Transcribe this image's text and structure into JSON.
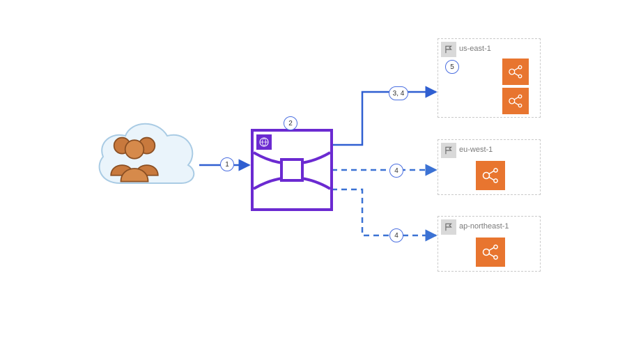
{
  "steps": {
    "s1": "1",
    "s2": "2",
    "s34": "3, 4",
    "s4a": "4",
    "s4b": "4",
    "s5": "5"
  },
  "regions": {
    "r1": "us-east-1",
    "r2": "eu-west-1",
    "r3": "ap-northeast-1"
  },
  "icons": {
    "users": "users-icon",
    "cloud": "cloud-icon",
    "cloudfront": "cloudfront-icon",
    "flag": "region-flag-icon",
    "service": "load-balancer-icon"
  },
  "colors": {
    "cloudfront_border": "#6b2ad1",
    "service_bg": "#e8752f",
    "arrow_solid": "#2f5fd1",
    "arrow_dashed": "#3b72d4",
    "cloud_outline": "#a9cbe4",
    "cloud_fill": "#eaf4fb",
    "region_border": "#c9c9c9",
    "step_border": "#4a6ee0"
  }
}
